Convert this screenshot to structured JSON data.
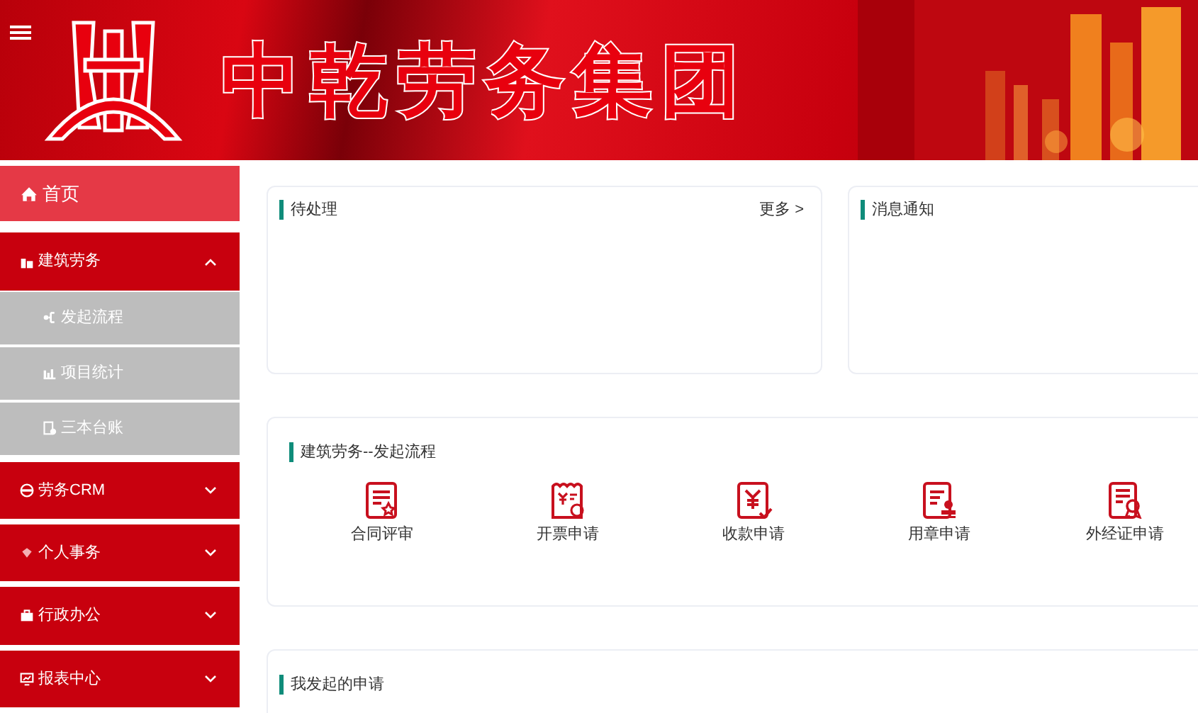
{
  "header": {
    "title": "中乾劳务集团"
  },
  "sidebar": {
    "items": [
      {
        "label": "首页",
        "selected": true
      },
      {
        "label": "建筑劳务",
        "selected": false,
        "expanded": true,
        "children": [
          {
            "label": "发起流程"
          },
          {
            "label": "项目统计"
          },
          {
            "label": "三本台账"
          }
        ]
      },
      {
        "label": "劳务CRM",
        "selected": false,
        "expanded": false
      },
      {
        "label": "个人事务",
        "selected": false,
        "expanded": false
      },
      {
        "label": "行政办公",
        "selected": false,
        "expanded": false
      },
      {
        "label": "报表中心",
        "selected": false,
        "expanded": false
      }
    ]
  },
  "pending": {
    "title": "待处理",
    "more": "更多 >"
  },
  "notices": {
    "title": "消息通知"
  },
  "workflow": {
    "title": "建筑劳务--发起流程",
    "actions": [
      {
        "label": "合同评审"
      },
      {
        "label": "开票申请"
      },
      {
        "label": "收款申请"
      },
      {
        "label": "用章申请"
      },
      {
        "label": "外经证申请"
      }
    ]
  },
  "my_requests": {
    "title": "我发起的申请"
  }
}
